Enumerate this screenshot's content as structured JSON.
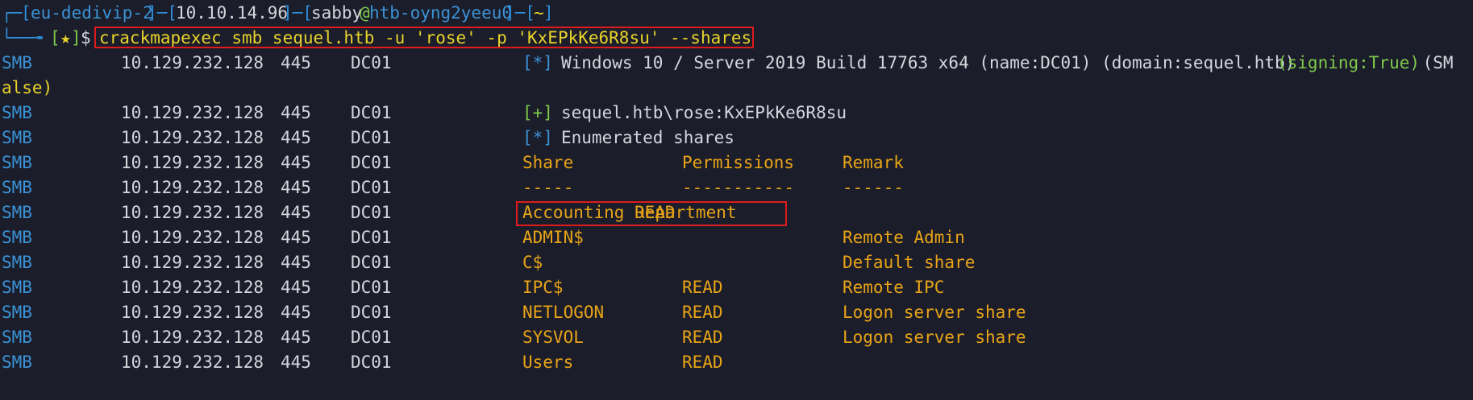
{
  "prompt": {
    "corner_top": "┌─",
    "corner_bottom": "└──╼",
    "host": "eu-dedivip-2",
    "ip": "10.10.14.96",
    "user": "sabby",
    "at": "@",
    "machine": "htb-oyng2yeeu0",
    "dir": "~",
    "star": "★",
    "dollar": "$",
    "command": "crackmapexec smb sequel.htb -u 'rose' -p 'KxEPkKe6R8su' --shares"
  },
  "row_prefix": {
    "proto": "SMB",
    "ip": "10.129.232.128",
    "port": "445",
    "host": "DC01"
  },
  "info_line": {
    "marker": "[*]",
    "text": "Windows 10 / Server 2019 Build 17763 x64 (name:DC01) (domain:sequel.htb) ",
    "signing": "(signing:True)",
    "rest": " (SM",
    "wrap": "alse)"
  },
  "auth_line": {
    "marker": "[+]",
    "text": "sequel.htb\\rose:KxEPkKe6R8su"
  },
  "enum_line": {
    "marker": "[*]",
    "text": "Enumerated shares"
  },
  "shares_table": {
    "headers": {
      "share": "Share",
      "permissions": "Permissions",
      "remark": "Remark"
    },
    "separators": {
      "share": "-----",
      "permissions": "-----------",
      "remark": "------"
    },
    "rows": [
      {
        "share": "Accounting Department",
        "permissions": "READ",
        "remark": ""
      },
      {
        "share": "ADMIN$",
        "permissions": "",
        "remark": "Remote Admin"
      },
      {
        "share": "C$",
        "permissions": "",
        "remark": "Default share"
      },
      {
        "share": "IPC$",
        "permissions": "READ",
        "remark": "Remote IPC"
      },
      {
        "share": "NETLOGON",
        "permissions": "READ",
        "remark": "Logon server share"
      },
      {
        "share": "SYSVOL",
        "permissions": "READ",
        "remark": "Logon server share"
      },
      {
        "share": "Users",
        "permissions": "READ",
        "remark": ""
      }
    ]
  },
  "colors": {
    "background": "#1b1d2b",
    "highlight_box": "#e01b1b",
    "proto": "#3b93d6",
    "share_text": "#e8a416",
    "command": "#e9d32a"
  }
}
